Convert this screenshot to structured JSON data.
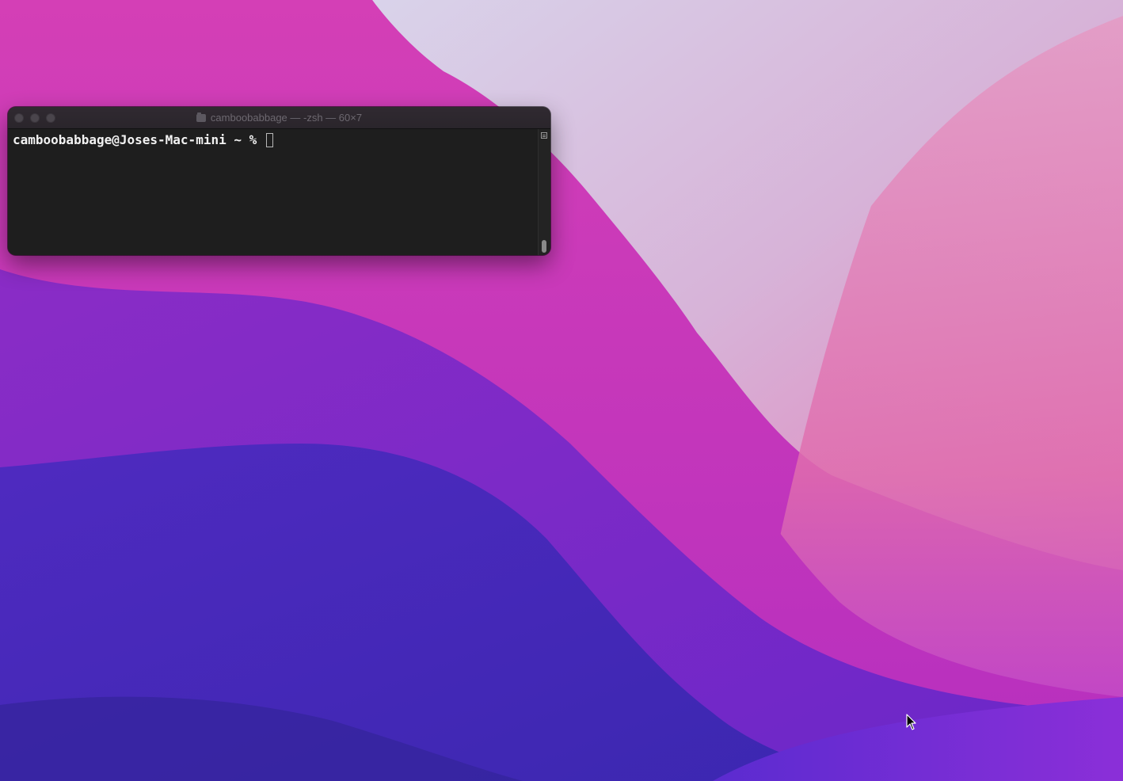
{
  "desktop": {
    "wallpaper": "macos-monterey-wallpaper"
  },
  "terminal": {
    "title": "camboobabbage — -zsh — 60×7",
    "prompt": "camboobabbage@Joses-Mac-mini ~ % ",
    "icon": "folder-icon"
  },
  "colors": {
    "terminal_bg": "#1e1e1e",
    "text": "#f2f2f2",
    "title_text": "#6d6870"
  }
}
